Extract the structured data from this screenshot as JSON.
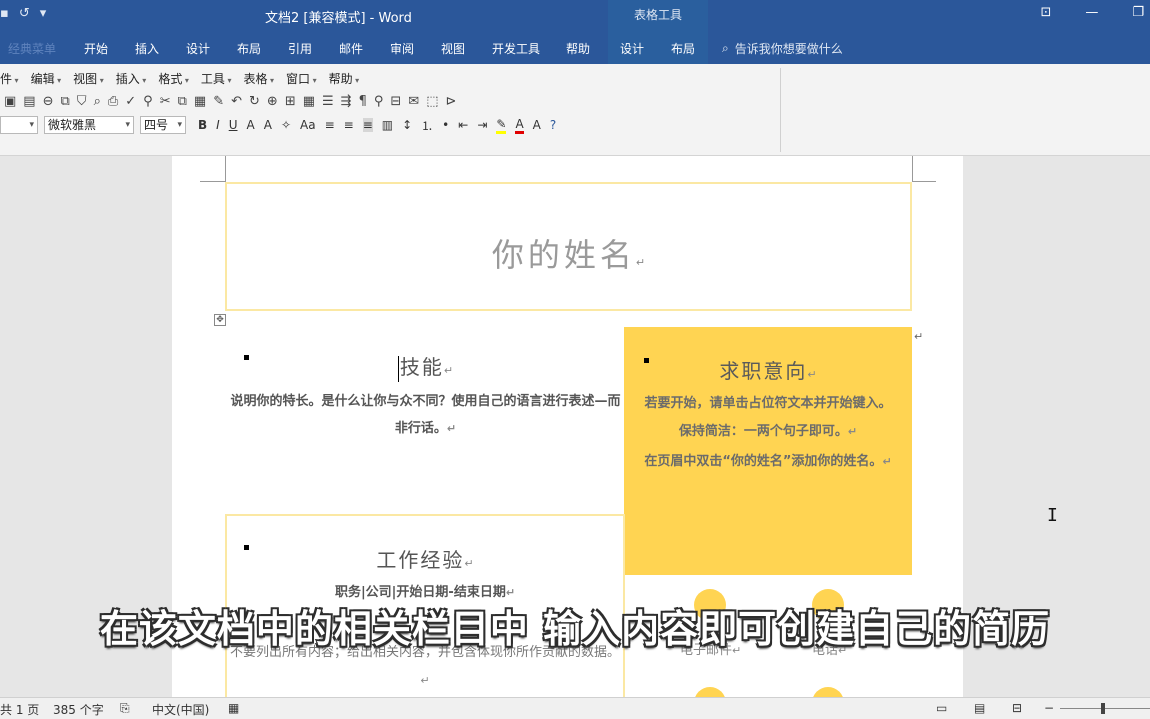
{
  "titlebar": {
    "title": "文档2 [兼容模式] - Word",
    "context_tab_group": "表格工具",
    "qat_icons": [
      "save-icon",
      "undo-icon",
      "redo-icon",
      "customize-icon"
    ]
  },
  "ribbon": {
    "tabs": [
      {
        "label": "经典菜单",
        "faint": true
      },
      {
        "label": "开始"
      },
      {
        "label": "插入"
      },
      {
        "label": "设计"
      },
      {
        "label": "布局"
      },
      {
        "label": "引用"
      },
      {
        "label": "邮件"
      },
      {
        "label": "审阅"
      },
      {
        "label": "视图"
      },
      {
        "label": "开发工具"
      },
      {
        "label": "帮助"
      },
      {
        "label": "设计"
      },
      {
        "label": "布局"
      }
    ],
    "search_text": "告诉我你想要做什么"
  },
  "classic_menu": [
    "件",
    "编辑",
    "视图",
    "插入",
    "格式",
    "工具",
    "表格",
    "窗口",
    "帮助"
  ],
  "format_bar": {
    "font_name": "微软雅黑",
    "font_size": "四号",
    "bold": "B",
    "italic": "I",
    "underline": "U",
    "case": "Aa"
  },
  "document": {
    "name_placeholder": "你的姓名",
    "paragraph_mark": "↵",
    "skills": {
      "title": "技能",
      "text": "说明你的特长。是什么让你与众不同？使用自己的语言进行表述—而非行话。"
    },
    "objective": {
      "title": "求职意向",
      "text1": "若要开始，请单击占位符文本并开始键入。保持简洁：一两个句子即可。",
      "text2": "在页眉中双击“你的姓名”添加你的姓名。"
    },
    "experience": {
      "title": "工作经验",
      "line1": "职务|公司|开始日期-结束日期",
      "line2": "不要列出所有内容；给出相关内容，并包含体现你所作贡献的数据。"
    },
    "contact": {
      "email": "电子邮件",
      "phone": "电话"
    }
  },
  "subtitle": "在该文档中的相关栏目中  输入内容即可创建自己的简历",
  "status": {
    "page": "共 1 页",
    "words": "385 个字",
    "language": "中文(中国)"
  },
  "colors": {
    "word_blue": "#2b579a",
    "accent_yellow": "#ffd452",
    "border_yellow": "#fbe8a3"
  }
}
